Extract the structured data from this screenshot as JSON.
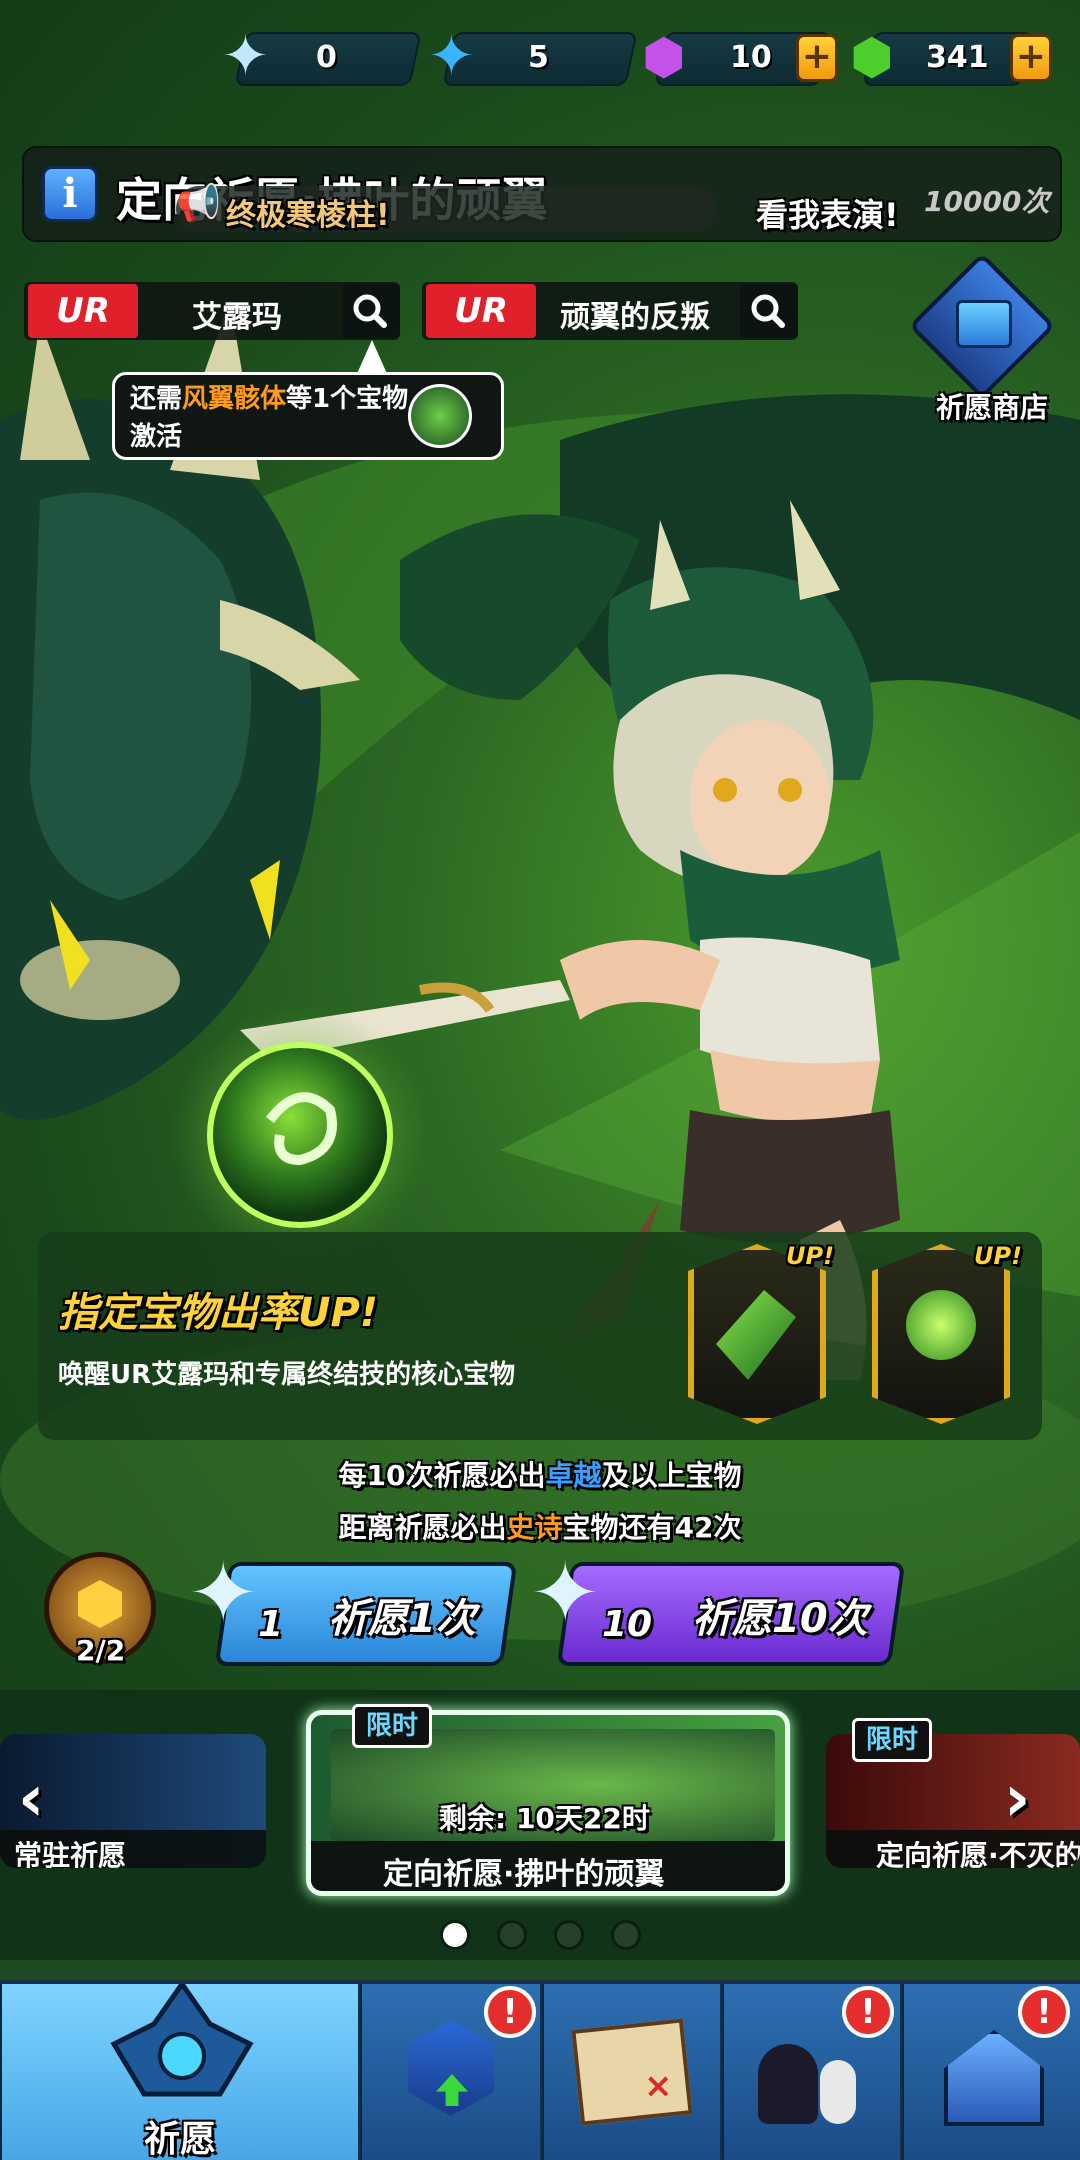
{
  "currencies": [
    {
      "icon": "rainbow-star-icon",
      "value": "0"
    },
    {
      "icon": "blue-star-icon",
      "value": "5"
    },
    {
      "icon": "purple-gem-icon",
      "value": "10"
    },
    {
      "icon": "green-gem-icon",
      "value": "341"
    }
  ],
  "banner": {
    "title": "定向祈愿·拂叶的顽翼",
    "marquee_left": "终极寒棱柱!",
    "marquee_right": "看我表演!",
    "counter": "10000次"
  },
  "search": [
    {
      "rarity": "UR",
      "name": "艾露玛"
    },
    {
      "rarity": "UR",
      "name": "顽翼的反叛"
    }
  ],
  "tooltip": {
    "prefix": "还需",
    "highlight": "风翼骸体",
    "suffix": "等1个宝物激活"
  },
  "shop": {
    "label": "祈愿商店"
  },
  "up_panel": {
    "title": "指定宝物出率UP!",
    "subtitle": "唤醒UR艾露玛和专属终结技的核心宝物",
    "tag": "UP!"
  },
  "guarantee": {
    "line1_a": "每10次祈愿必出",
    "line1_hl": "卓越",
    "line1_b": "及以上宝物",
    "line2_a": "距离祈愿必出",
    "line2_hl": "史诗",
    "line2_b": "宝物还有42次"
  },
  "ticket": {
    "count": "2/2"
  },
  "pull_buttons": [
    {
      "cost": "1",
      "label": "祈愿1次"
    },
    {
      "cost": "10",
      "label": "祈愿10次"
    }
  ],
  "carousel": {
    "left": {
      "label": "常驻祈愿"
    },
    "center": {
      "tag": "限时",
      "remaining": "剩余: 10天22时",
      "label": "定向祈愿·拂叶的顽翼"
    },
    "right": {
      "tag": "限时",
      "label": "定向祈愿·不灭的"
    }
  },
  "nav": {
    "active_label": "祈愿",
    "badge": "!"
  },
  "colors": {
    "accent_yellow": "#ffd23a",
    "hl_blue": "#3aa0ff",
    "hl_orange": "#ff9a1a",
    "ur_red": "#e0202a",
    "pull_blue": "#3aa2e6",
    "pull_purple": "#8a3fe0"
  }
}
